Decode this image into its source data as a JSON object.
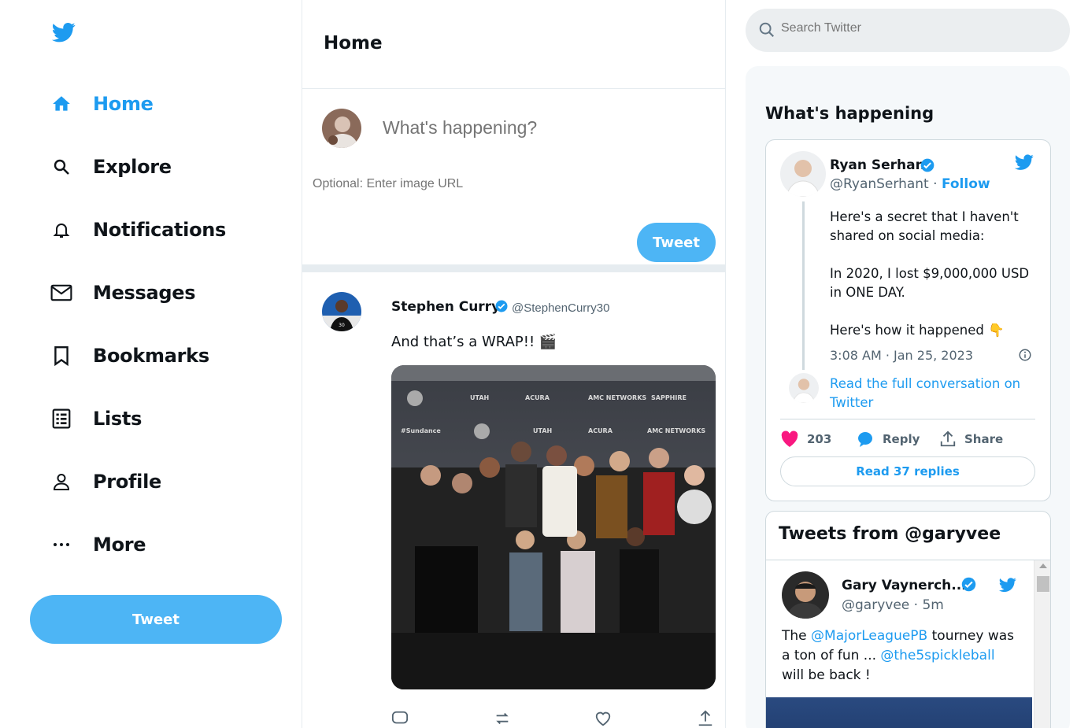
{
  "nav": {
    "items": [
      {
        "label": "Home",
        "icon": "home-icon"
      },
      {
        "label": "Explore",
        "icon": "search-icon"
      },
      {
        "label": "Notifications",
        "icon": "bell-icon"
      },
      {
        "label": "Messages",
        "icon": "envelope-icon"
      },
      {
        "label": "Bookmarks",
        "icon": "bookmark-icon"
      },
      {
        "label": "Lists",
        "icon": "list-icon"
      },
      {
        "label": "Profile",
        "icon": "person-icon"
      },
      {
        "label": "More",
        "icon": "ellipsis-icon"
      }
    ],
    "tweet_button": "Tweet"
  },
  "main": {
    "title": "Home",
    "composer": {
      "placeholder": "What's happening?",
      "image_url_placeholder": "Optional: Enter image URL",
      "button": "Tweet"
    },
    "tweet": {
      "name": "Stephen Curry",
      "handle": "@StephenCurry30",
      "text": "And that’s a WRAP!! 🎬"
    }
  },
  "right": {
    "search_placeholder": "Search Twitter",
    "happening_title": "What's happening",
    "embed": {
      "name": "Ryan Serhant",
      "handle": "@RyanSerhant",
      "separator": " · ",
      "follow": "Follow",
      "paragraphs": [
        "Here's a secret that I haven't shared on social media:",
        "In 2020, I lost $9,000,000 USD in ONE DAY.",
        "Here's how it happened 👇"
      ],
      "time": "3:08 AM · Jan 25, 2023",
      "read_conversation": "Read the full conversation on Twitter",
      "likes": "203",
      "reply": "Reply",
      "share": "Share",
      "read_replies": "Read 37 replies"
    },
    "timeline": {
      "title": "Tweets from @garyvee",
      "name": "Gary Vaynerch...",
      "handle": "@garyvee · 5m",
      "text_parts": [
        "The ",
        "@MajorLeaguePB",
        " tourney was a ton of fun ... ",
        "@the5spickleball",
        " will be back !"
      ]
    }
  },
  "colors": {
    "accent": "#1d9bf0",
    "button": "#4db5f5",
    "like": "#f91880"
  }
}
